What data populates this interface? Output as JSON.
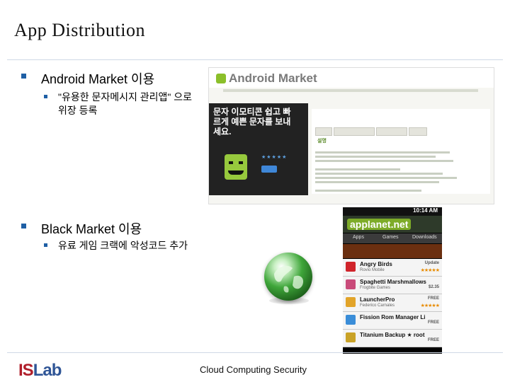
{
  "slide": {
    "title": "App Distribution",
    "bullets": [
      {
        "label": "Android Market 이용",
        "sub": [
          "\"유용한 문자메시지 관리앱\" 으로 위장 등록"
        ]
      },
      {
        "label": "Black Market 이용",
        "sub": [
          "유료 게임 크랙에 악성코드 추가"
        ]
      }
    ],
    "footer": "Cloud Computing Security",
    "logo": {
      "part1": "IS",
      "part2": "Lab"
    }
  },
  "android_market_shot": {
    "logo_text": "Android Market",
    "headline": "문자 이모티콘 쉽고 빠르게 예쁜 문자를 보내세요.",
    "section": "설명"
  },
  "applanet_shot": {
    "time": "10:14 AM",
    "logo": "applanet.net",
    "tabs": [
      "Apps",
      "Games",
      "Downloads"
    ],
    "apps": [
      {
        "name": "Angry Birds",
        "dev": "Rovio Mobile",
        "right": "Update",
        "icon_color": "#d0242b"
      },
      {
        "name": "Spaghetti Marshmallows",
        "dev": "Frogbite Games",
        "right": "$2.35",
        "icon_color": "#c94b7a"
      },
      {
        "name": "LauncherPro",
        "dev": "Federico Carnales",
        "right": "FREE",
        "icon_color": "#e2a42a"
      },
      {
        "name": "Fission Rom Manager Li",
        "dev": "",
        "right": "FREE",
        "icon_color": "#3a8dd8"
      },
      {
        "name": "Titanium Backup ★ root",
        "dev": "",
        "right": "FREE",
        "icon_color": "#c9a227"
      }
    ]
  },
  "colors": {
    "bullet": "#1f5fa5",
    "logo_red": "#b01e2a",
    "logo_blue": "#2f5596"
  }
}
